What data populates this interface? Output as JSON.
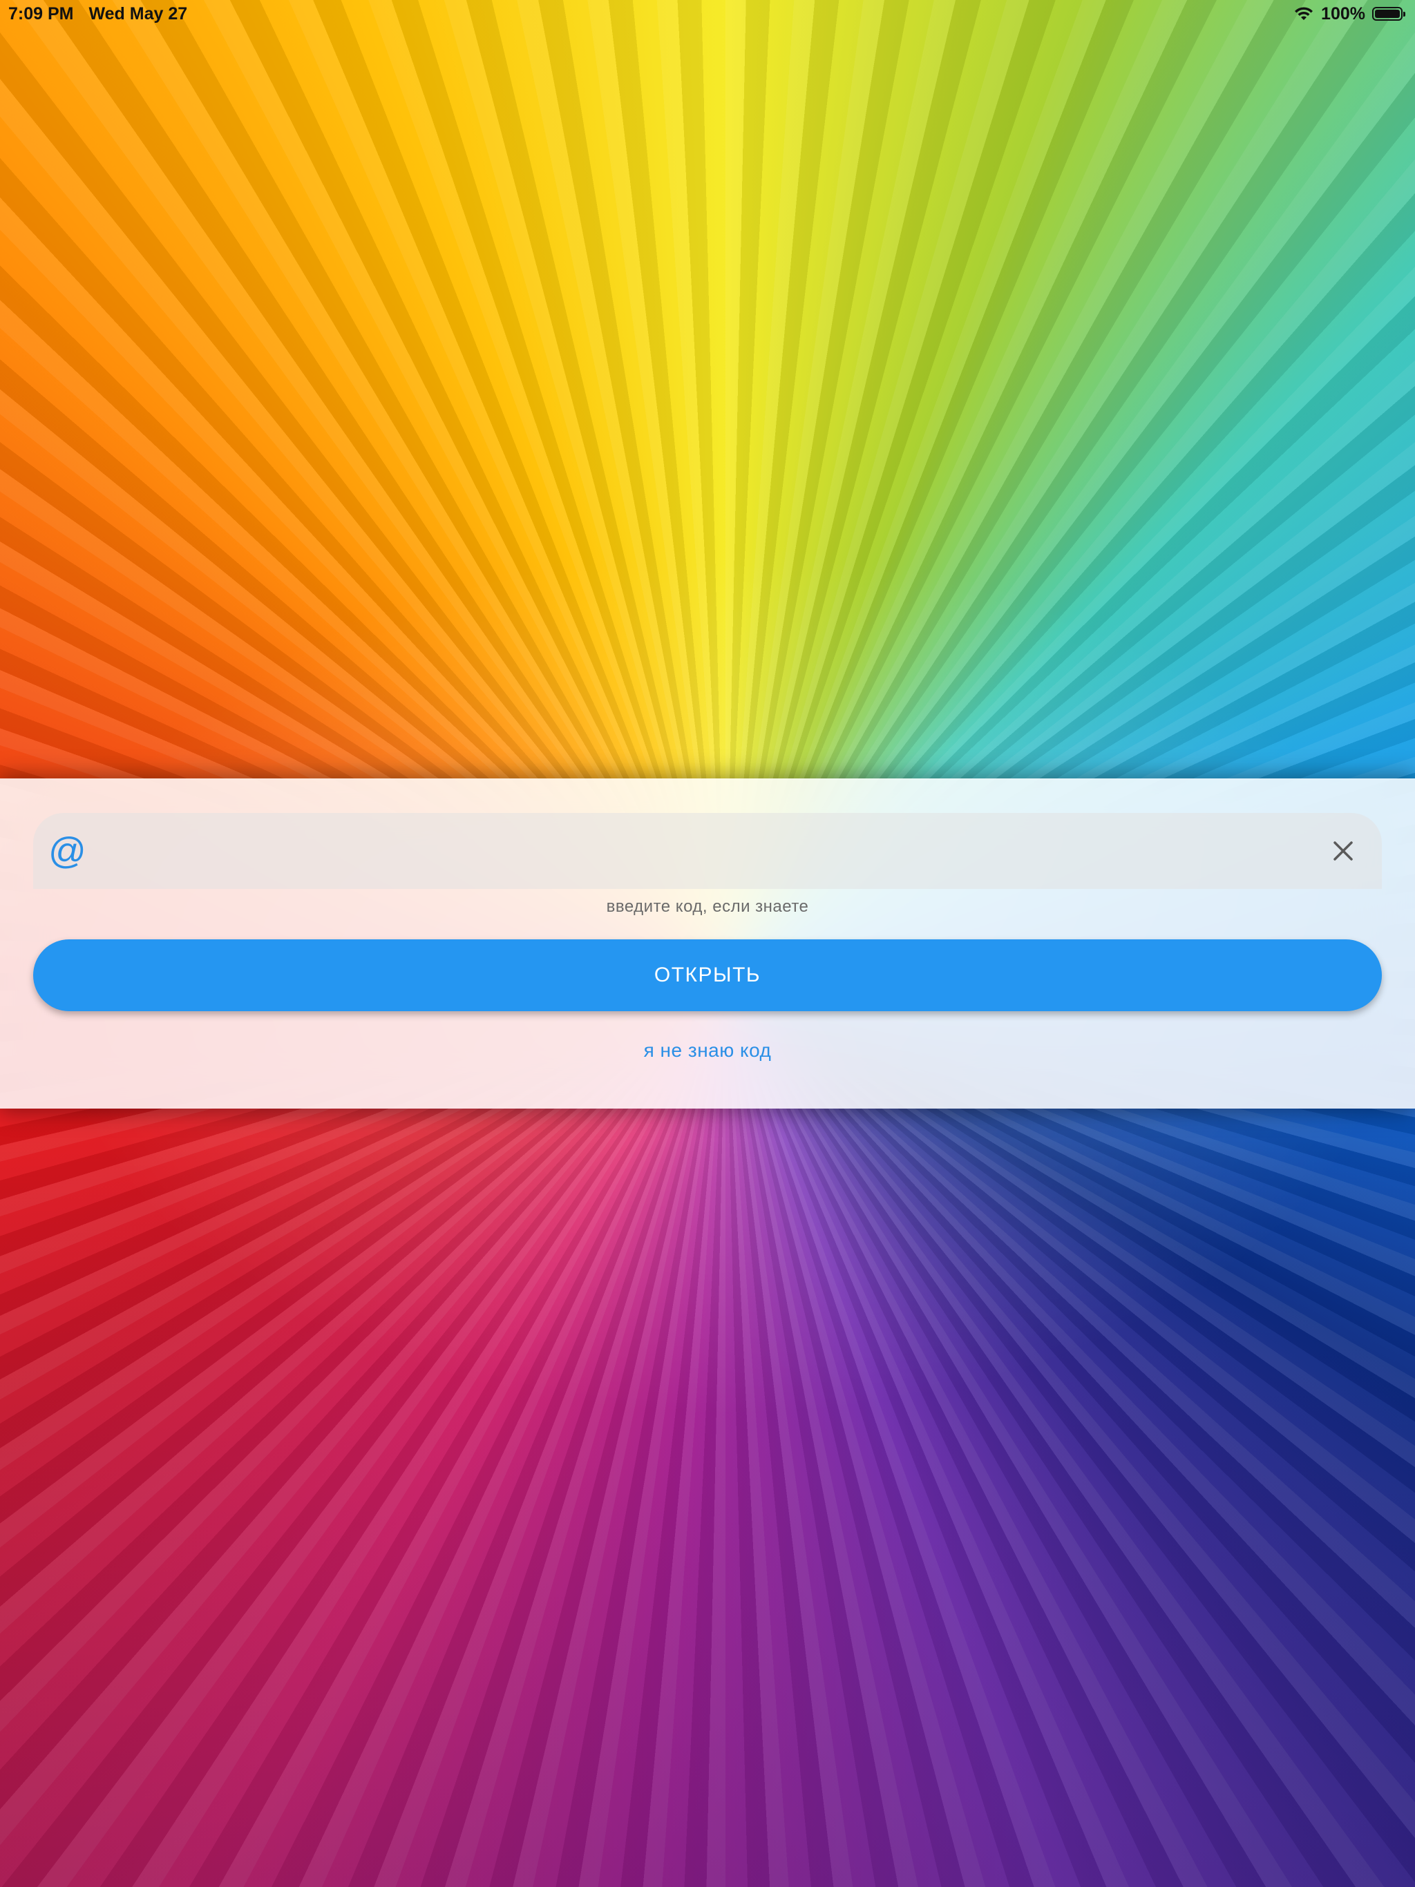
{
  "status_bar": {
    "time": "7:09 PM",
    "date": "Wed May 27",
    "battery_percent": "100%",
    "icons": [
      "wifi-icon",
      "battery-icon"
    ]
  },
  "code_form": {
    "input_prefix_icon": "@",
    "input_value": "",
    "clear_icon": "close-icon",
    "helper_text": "введите код, если знаете",
    "open_button_label": "ОТКРЫТЬ",
    "dont_know_link": "я не знаю код"
  },
  "colors": {
    "accent": "#2596f1",
    "link": "#2a8fe6"
  }
}
